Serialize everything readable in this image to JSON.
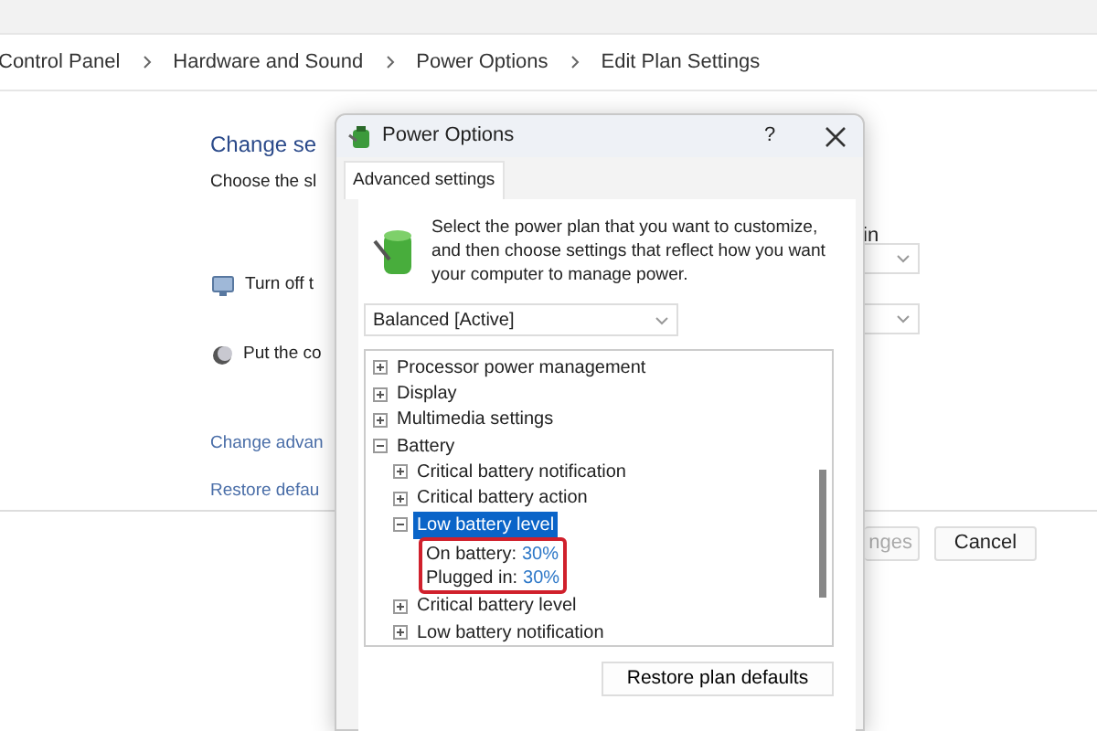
{
  "breadcrumb": [
    "Control Panel",
    "Hardware and Sound",
    "Power Options",
    "Edit Plan Settings"
  ],
  "page": {
    "title": "Change se",
    "subtitle": "Choose the sl",
    "column_header": "in",
    "settings": [
      {
        "label": "Turn off t"
      },
      {
        "label": "Put the co"
      }
    ],
    "links": [
      "Change advan",
      "Restore defau"
    ],
    "buttons": [
      "nges",
      "Cancel"
    ]
  },
  "dialog": {
    "title": "Power Options",
    "help": "?",
    "tab": {
      "label": "Advanced settings",
      "selected": true
    },
    "description": "Select the power plan that you want to customize, and then choose settings that reflect how you want your computer to manage power.",
    "plan": "Balanced [Active]",
    "tree": [
      {
        "label": "Processor power management",
        "expanded": false,
        "selected": false
      },
      {
        "label": "Display",
        "expanded": false,
        "selected": false
      },
      {
        "label": "Multimedia settings",
        "expanded": false,
        "selected": false
      },
      {
        "label": "Battery",
        "expanded": true,
        "selected": false,
        "children": [
          {
            "label": "Critical battery notification",
            "expanded": false,
            "selected": false
          },
          {
            "label": "Critical battery action",
            "expanded": false,
            "selected": false
          },
          {
            "label": "Low battery level",
            "expanded": true,
            "selected": true,
            "highlighted_children": true,
            "children": [
              {
                "label": "On battery:",
                "value": "30%"
              },
              {
                "label": "Plugged in:",
                "value": "30%"
              }
            ]
          },
          {
            "label": "Critical battery level",
            "expanded": false,
            "selected": false
          },
          {
            "label": "Low battery notification",
            "expanded": false,
            "selected": false
          }
        ]
      }
    ],
    "buttons": [
      "Restore plan defaults"
    ]
  }
}
